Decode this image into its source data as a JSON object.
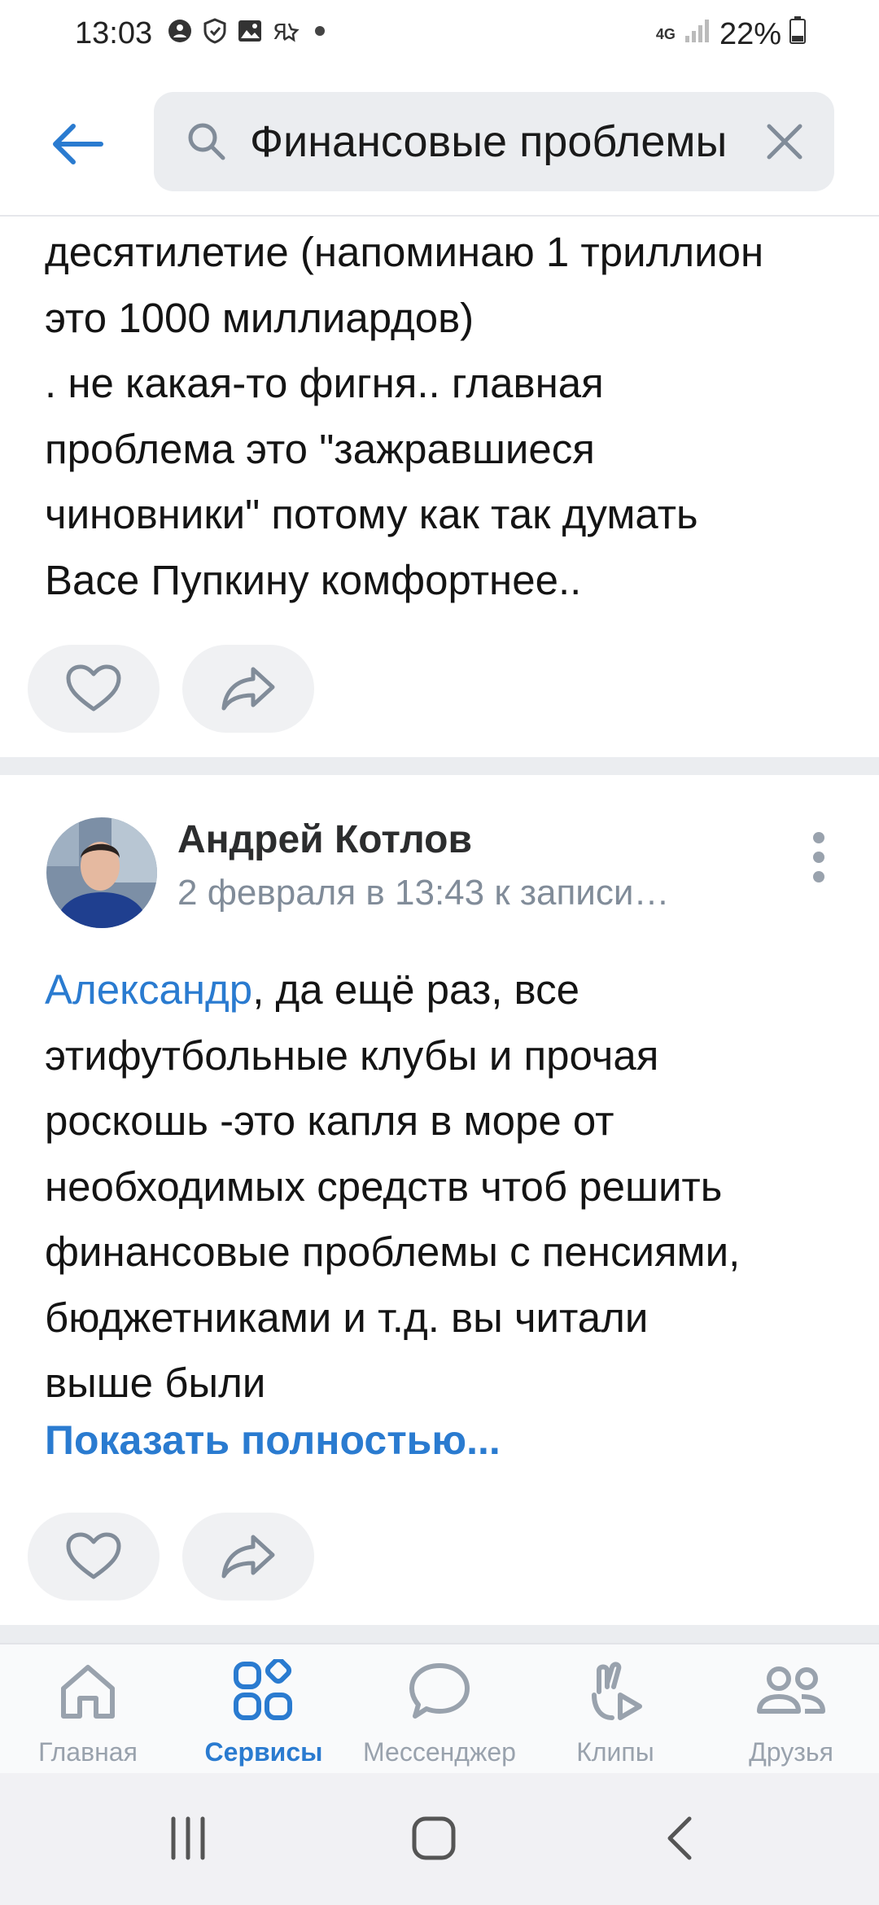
{
  "status_bar": {
    "time": "13:03",
    "network": "4G",
    "battery": "22%",
    "left_icons": [
      "notification-dot-icon",
      "shield-icon",
      "gallery-icon",
      "vk-icon",
      "dot-icon"
    ]
  },
  "search": {
    "query": "Финансовые проблемы",
    "back_icon": "arrow-left-icon",
    "search_icon": "search-icon",
    "clear_icon": "close-icon"
  },
  "post1": {
    "lines": [
      "десятилетие (напоминаю 1 триллион",
      "это 1000 миллиардов)",
      ". не какая-то фигня.. главная",
      "проблема это \"зажравшиеся",
      "чиновники\" потому как так думать",
      "Васе Пупкину комфортнее.."
    ]
  },
  "post2": {
    "author": "Андрей Котлов",
    "meta": "2 февраля в 13:43 к записи…",
    "mention": "Александр",
    "first_line_rest": ", да ещё раз, все",
    "lines": [
      "этифутбольные клубы и прочая",
      "роскошь -это капля в море  от",
      "необходимых средств чтоб решить",
      "финансовые проблемы с пенсиями,",
      "бюджетниками и т.д. вы читали",
      "выше были"
    ],
    "show_more": "Показать полностью..."
  },
  "bottom_nav": {
    "items": [
      {
        "label": "Главная",
        "icon": "home-icon",
        "active": false
      },
      {
        "label": "Сервисы",
        "icon": "services-icon",
        "active": true
      },
      {
        "label": "Мессенджер",
        "icon": "chat-icon",
        "active": false
      },
      {
        "label": "Клипы",
        "icon": "clips-icon",
        "active": false
      },
      {
        "label": "Друзья",
        "icon": "friends-icon",
        "active": false
      }
    ]
  },
  "colors": {
    "accent": "#2a7bd0",
    "muted": "#99a2ad",
    "separator": "#ebedf0"
  }
}
